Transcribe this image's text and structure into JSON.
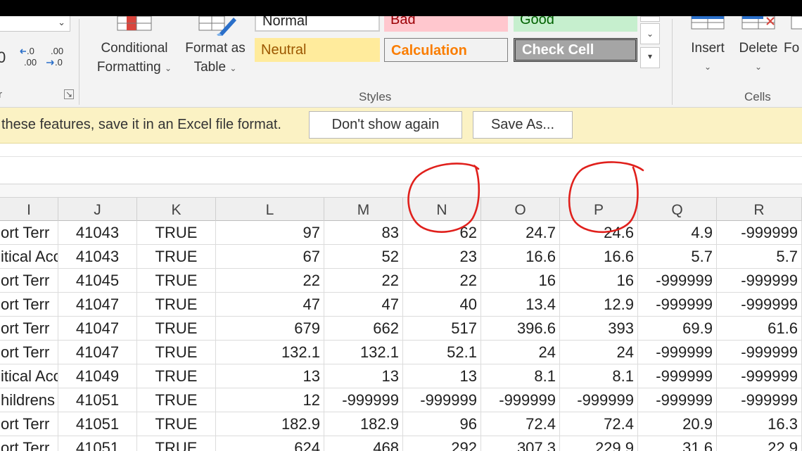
{
  "ribbon": {
    "dec_increase": ".0\n.00",
    "dec_decrease": ".00\n.0",
    "partial_number_glyph": "0",
    "partial_group_label": "r",
    "conditional_formatting": {
      "line1": "Conditional",
      "line2": "Formatting"
    },
    "format_as_table": {
      "line1": "Format as",
      "line2": "Table"
    },
    "styles": {
      "normal": "Normal",
      "bad": "Bad",
      "good": "Good",
      "neutral": "Neutral",
      "calculation": "Calculation",
      "check_cell": "Check Cell"
    },
    "styles_group_label": "Styles",
    "insert": "Insert",
    "delete": "Delete",
    "format_partial": "Fo",
    "cells_group_label": "Cells",
    "colors": {
      "bad_bg": "#ffc7ce",
      "bad_fg": "#9c0006",
      "good_bg": "#c6efce",
      "good_fg": "#006100",
      "neutral_bg": "#ffeb9c",
      "neutral_fg": "#9c5700",
      "calc_bg": "#f2f2f2",
      "calc_fg": "#fa7d00",
      "check_bg": "#a5a5a5",
      "check_fg": "#ffffff"
    }
  },
  "message_bar": {
    "text": "these features, save it in an Excel file format.",
    "dont_show_again": "Don't show again",
    "save_as": "Save As..."
  },
  "columns": [
    "I",
    "J",
    "K",
    "L",
    "M",
    "N",
    "O",
    "P",
    "Q",
    "R"
  ],
  "circled_columns": [
    "N",
    "P"
  ],
  "annotation_color": "#e0201c",
  "rows": [
    [
      "ort Terr",
      "41043",
      "TRUE",
      "97",
      "83",
      "62",
      "24.7",
      "24.6",
      "4.9",
      "-999999"
    ],
    [
      "itical Acc",
      "41043",
      "TRUE",
      "67",
      "52",
      "23",
      "16.6",
      "16.6",
      "5.7",
      "5.7"
    ],
    [
      "ort Terr",
      "41045",
      "TRUE",
      "22",
      "22",
      "22",
      "16",
      "16",
      "-999999",
      "-999999"
    ],
    [
      "ort Terr",
      "41047",
      "TRUE",
      "47",
      "47",
      "40",
      "13.4",
      "12.9",
      "-999999",
      "-999999"
    ],
    [
      "ort Terr",
      "41047",
      "TRUE",
      "679",
      "662",
      "517",
      "396.6",
      "393",
      "69.9",
      "61.6"
    ],
    [
      "ort Terr",
      "41047",
      "TRUE",
      "132.1",
      "132.1",
      "52.1",
      "24",
      "24",
      "-999999",
      "-999999"
    ],
    [
      "itical Acc",
      "41049",
      "TRUE",
      "13",
      "13",
      "13",
      "8.1",
      "8.1",
      "-999999",
      "-999999"
    ],
    [
      "hildrens",
      "41051",
      "TRUE",
      "12",
      "-999999",
      "-999999",
      "-999999",
      "-999999",
      "-999999",
      "-999999"
    ],
    [
      "ort Terr",
      "41051",
      "TRUE",
      "182.9",
      "182.9",
      "96",
      "72.4",
      "72.4",
      "20.9",
      "16.3"
    ],
    [
      "ort Terr",
      "41051",
      "TRUE",
      "624",
      "468",
      "292",
      "307.3",
      "229.9",
      "31.6",
      "22.9"
    ]
  ]
}
